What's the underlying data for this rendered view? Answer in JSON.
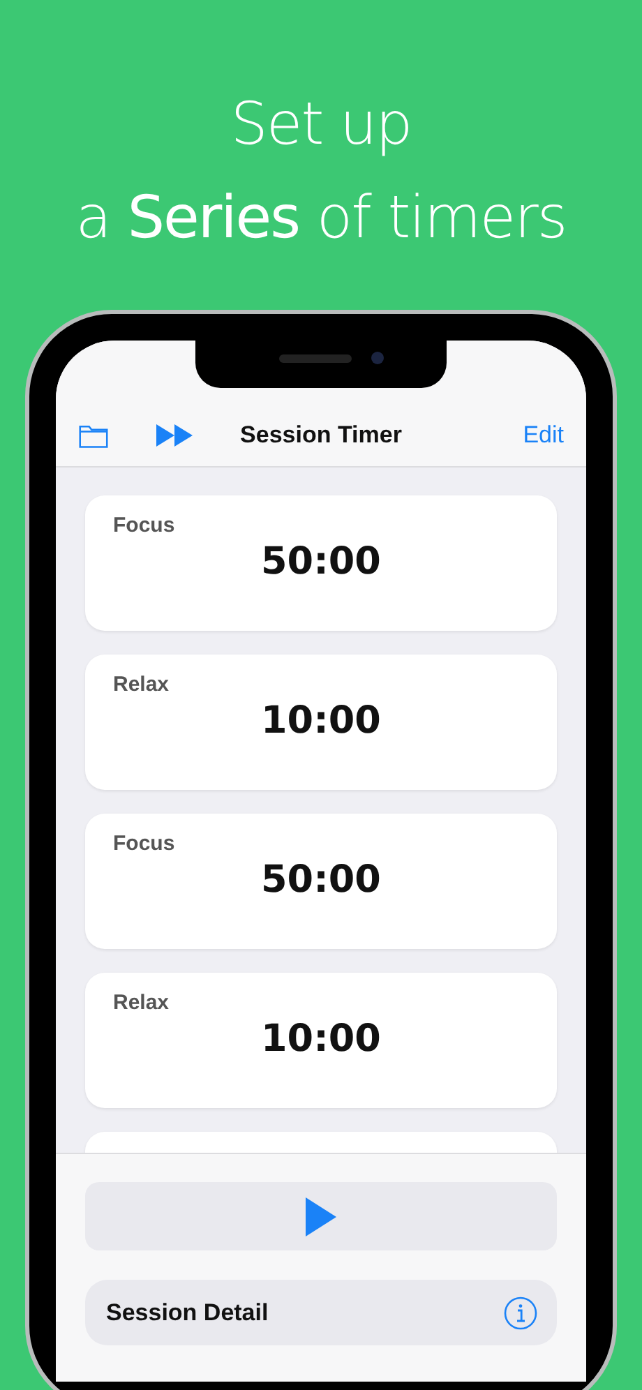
{
  "headline": {
    "line_1": "Set up",
    "line_2": "a **Series** of timers"
  },
  "nav_bar": {
    "title": "Session Timer",
    "edit": "Edit"
  },
  "timers": [
    {
      "label": "Focus",
      "time": "50:00"
    },
    {
      "label": "Relax",
      "time": "10:00"
    },
    {
      "label": "Focus",
      "time": "50:00"
    },
    {
      "label": "Relax",
      "time": "10:00"
    }
  ],
  "session_detail": {
    "label": "Session Detail"
  }
}
